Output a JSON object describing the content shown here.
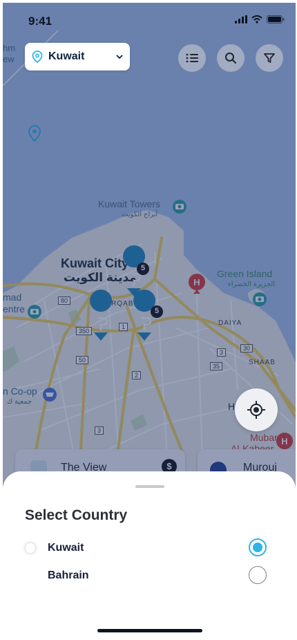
{
  "status_bar": {
    "time": "9:41"
  },
  "country_selector": {
    "value": "Kuwait"
  },
  "map": {
    "labels": {
      "towers_en": "Kuwait Towers",
      "towers_ar": "أبراج الكويت",
      "city_en": "Kuwait City",
      "city_ar": "مدينة الكويت",
      "green_island_en": "Green Island",
      "green_island_ar": "الجزيرة الخضراء",
      "mirqab": "MIRQAB",
      "daiya": "DAIYA",
      "shaab": "SHAAB",
      "coop_en": "n Co-op",
      "coop_ar": "جمعية ك",
      "hospital_en": "Mubarak",
      "hospital_en2": "Al-Kabeer Hospital",
      "left_mad": "mad",
      "left_entre": "entre",
      "left_ew": "ew",
      "left_hm": "hm",
      "h_mark": "H"
    },
    "road_signs": [
      "80",
      "350",
      "50",
      "1",
      "2",
      "3",
      "3",
      "30",
      "35"
    ],
    "cluster_counts": [
      "5",
      "5"
    ]
  },
  "cards": [
    {
      "title": "The View"
    },
    {
      "title": "Murouj"
    }
  ],
  "sheet": {
    "title": "Select Country",
    "options": [
      {
        "label": "Kuwait",
        "selected": true
      },
      {
        "label": "Bahrain",
        "selected": false
      }
    ]
  },
  "colors": {
    "accent": "#2fb4e9",
    "hospital": "#d93838",
    "parking": "#1f86b9"
  }
}
